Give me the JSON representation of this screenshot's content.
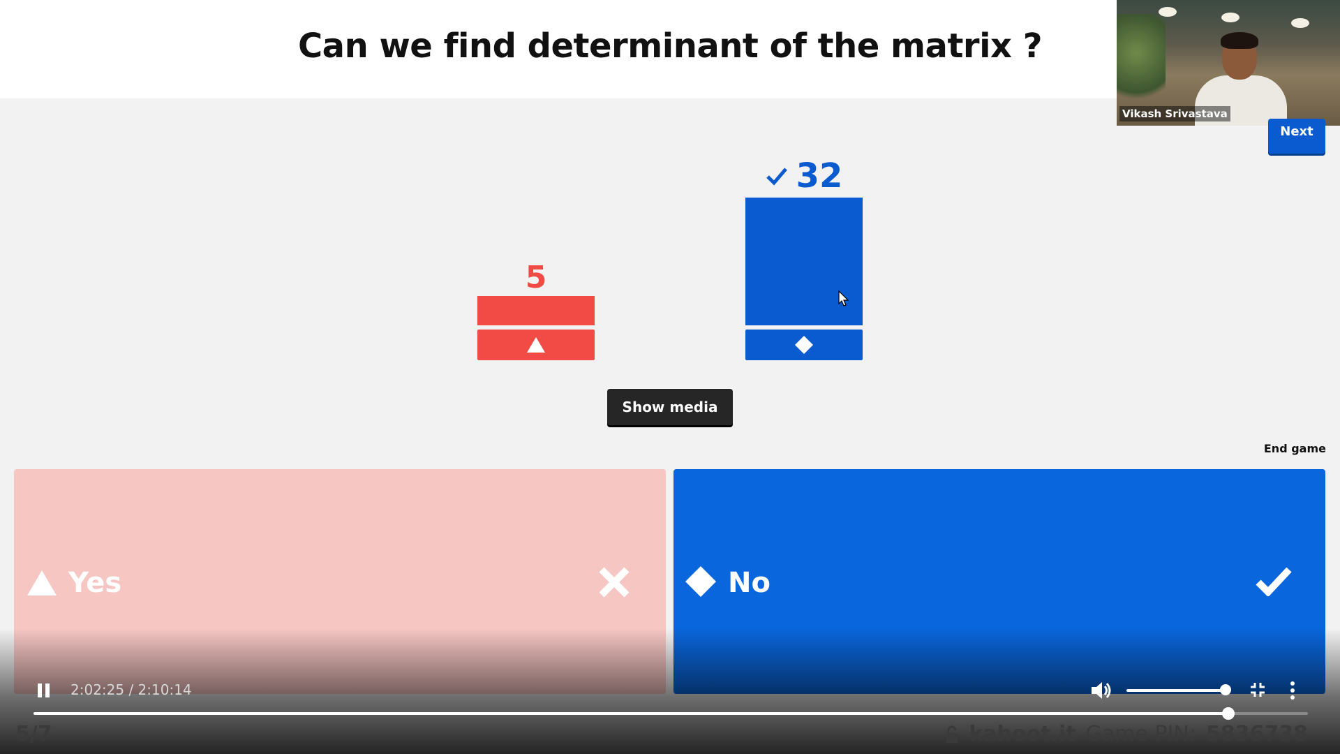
{
  "header": {
    "question": "Can we find determinant of the matrix ?"
  },
  "webcam": {
    "name": "Vikash Srivastava"
  },
  "controls": {
    "next_label": "Next",
    "show_media_label": "Show media",
    "end_game_label": "End game"
  },
  "results": [
    {
      "answer": "Yes",
      "count": "5",
      "count_value": 5,
      "shape": "triangle",
      "correct": false,
      "color": "#f24b45"
    },
    {
      "answer": "No",
      "count": "32",
      "count_value": 32,
      "shape": "diamond",
      "correct": true,
      "color": "#0a5bd0"
    }
  ],
  "answers": [
    {
      "label": "Yes",
      "shape": "triangle-icon",
      "mark": "cross-icon",
      "color": "#f6c6c3",
      "correct": false
    },
    {
      "label": "No",
      "shape": "diamond-icon",
      "mark": "check-icon",
      "color": "#0a66dc",
      "correct": true
    }
  ],
  "player": {
    "time": "2:02:25 / 2:10:14",
    "progress_fraction": 0.9375,
    "volume_fraction": 0.9
  },
  "footer": {
    "question_counter": "5/7",
    "brand": "kahoot.it",
    "pin_label": "Game PIN:",
    "pin": "5836738"
  }
}
